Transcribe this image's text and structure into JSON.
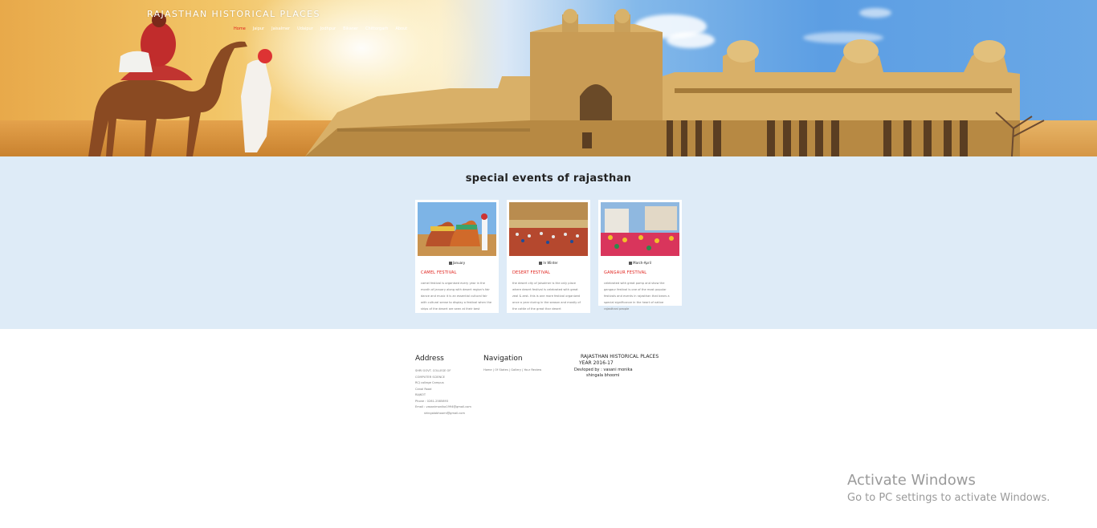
{
  "header": {
    "brand": "RAJASTHAN  HISTORICAL  PLACES",
    "nav": [
      {
        "label": "Home",
        "active": true
      },
      {
        "label": "Jaipur",
        "active": false
      },
      {
        "label": "Jaisalmer",
        "active": false
      },
      {
        "label": "Udaipur",
        "active": false
      },
      {
        "label": "Jodhpur",
        "active": false
      },
      {
        "label": "Bikaner",
        "active": false
      },
      {
        "label": "Chittorgarh",
        "active": false
      },
      {
        "label": "About",
        "active": false
      }
    ]
  },
  "events": {
    "title": "special events of rajasthan",
    "cards": [
      {
        "date": "January",
        "title": "CAMEL FESTIVAL",
        "description": "camel festival is organised every year in the month of january along with desert region's fair dance and music it is an essential cultural fair with cultural sense to display a festival when the ships of the desert are seen at their best"
      },
      {
        "date": "In Winter",
        "title": "DESERT FESTIVAL",
        "description": "the desert city of jaisalmer is the only place where desert festival is celebrated with great zeal & zest. this is one more festival organized once a year during in the season and mostly of the cattle of the great thar desert"
      },
      {
        "date": "March-April",
        "title": "GANGAUR FESTIVAL",
        "description": "celebrated with great pomp and show the gangaur festival is one of the most popular festivals and events in rajasthan that bears a special significance in the heart of native rajasthani people"
      }
    ]
  },
  "footer": {
    "address": {
      "heading": "Address",
      "lines": [
        "SHRI GOVT. COLLEGE OF",
        "COMPUTER SCIENCE",
        "RCJ college Campus",
        "Canal Road",
        "RAJKOT",
        "Phone : 0281-2585893",
        "Email : vasanimonika1994@gmail.com",
        "shingalabhoomi@gmail.com"
      ]
    },
    "navigation": {
      "heading": "Navigation",
      "links": "Home  |  Of States  |  Gallery  |  Your Review"
    },
    "info": {
      "title": "RAJASTHAN HISTORICAL PLACES",
      "year": "YEAR 2016-17",
      "developed_label": "Devloped by :",
      "developer1": "vasani monika",
      "developer2": "shingala bhoomi"
    }
  },
  "watermark": {
    "line1": "Activate Windows",
    "line2": "Go to PC settings to activate Windows."
  }
}
